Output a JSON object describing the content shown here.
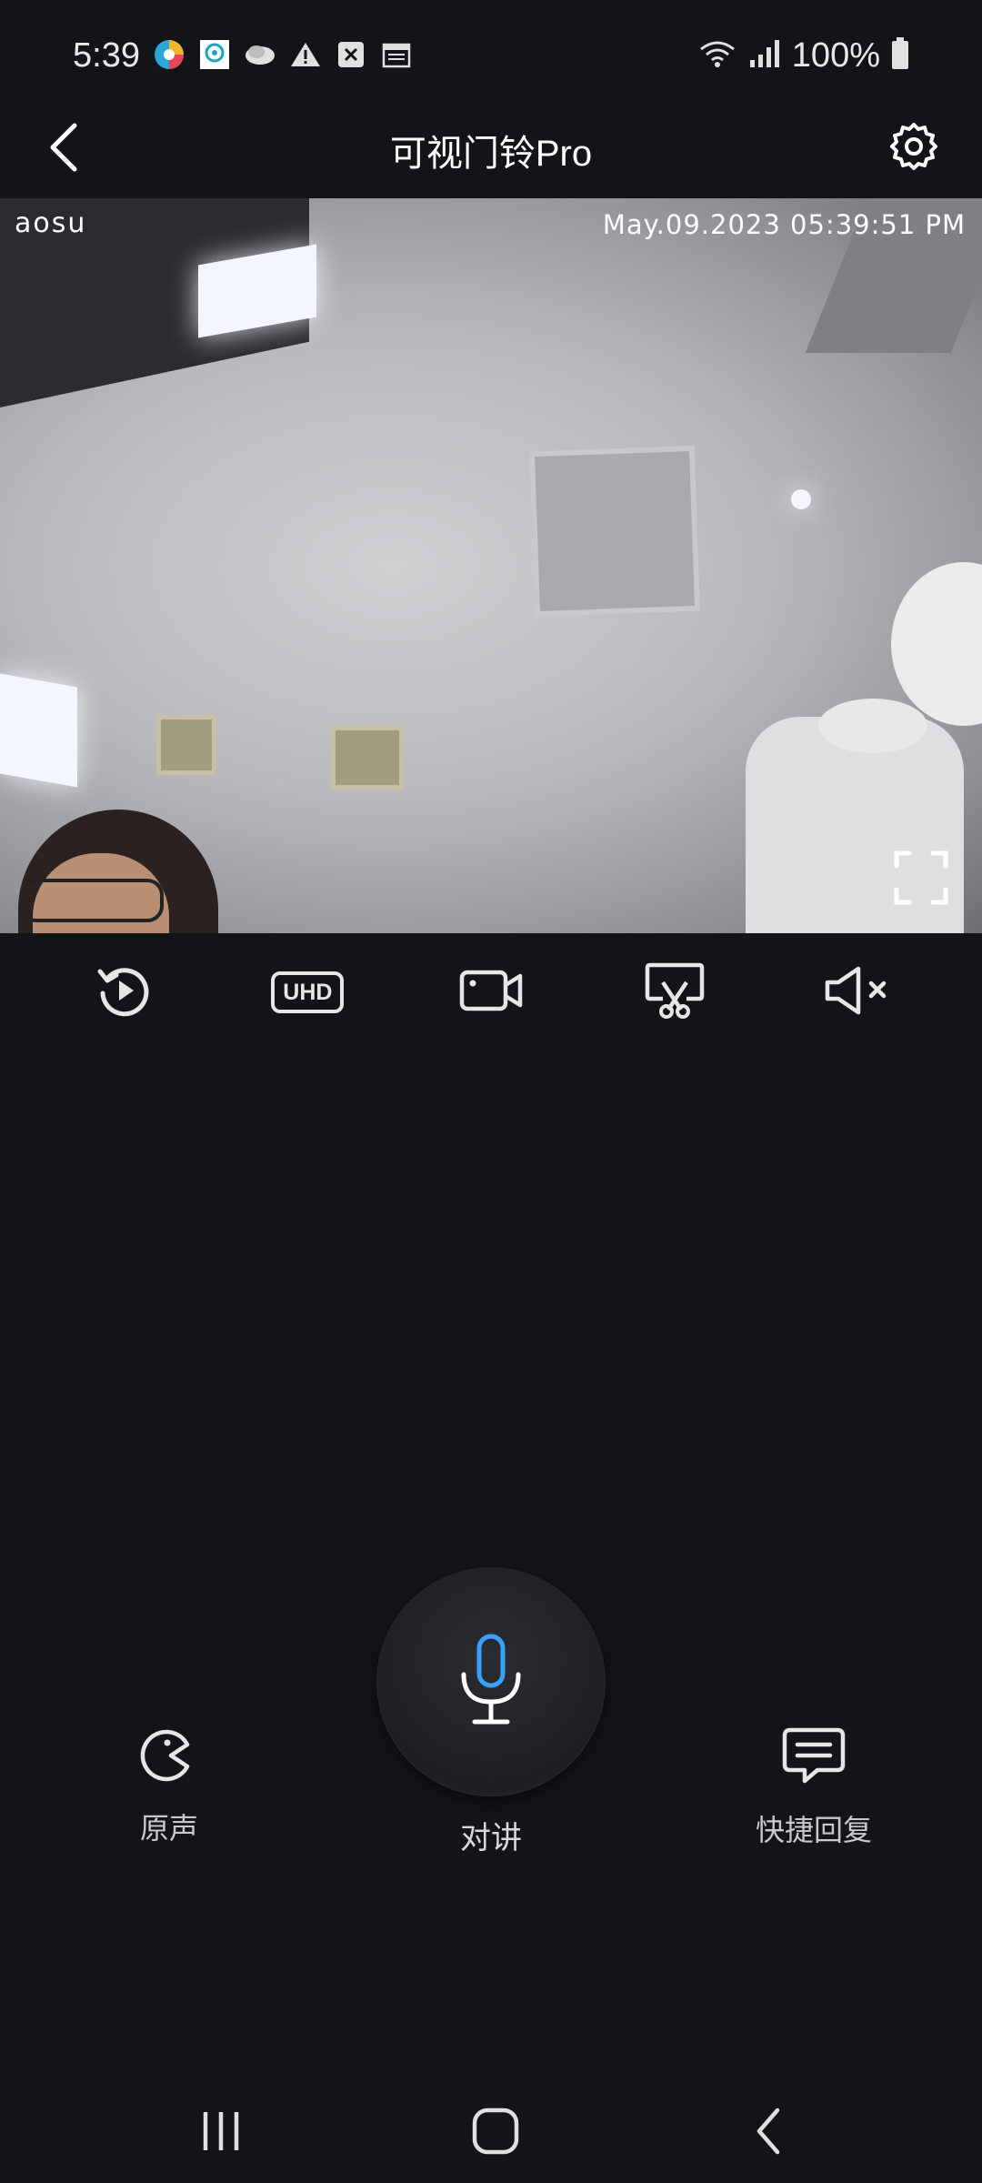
{
  "status_bar": {
    "time": "5:39",
    "battery_text": "100%",
    "notification_icons": [
      "colorful-app-icon",
      "location-pin-icon",
      "cloud-icon",
      "warning-icon",
      "close-box-icon",
      "calendar-icon"
    ]
  },
  "header": {
    "title": "可视门铃Pro",
    "back_icon": "chevron-left-icon",
    "settings_icon": "gear-icon"
  },
  "video": {
    "watermark_logo": "aosu",
    "timestamp": "May.09.2023 05:39:51 PM",
    "fullscreen_icon": "fullscreen-icon"
  },
  "toolbar": {
    "items": [
      {
        "name": "playback",
        "icon": "replay-icon"
      },
      {
        "name": "quality",
        "icon": "uhd-icon",
        "label": "UHD"
      },
      {
        "name": "record",
        "icon": "video-record-icon"
      },
      {
        "name": "screenshot",
        "icon": "screenshot-cut-icon"
      },
      {
        "name": "mute",
        "icon": "speaker-muted-icon"
      }
    ]
  },
  "actions": {
    "original_voice": "原声",
    "talk": "对讲",
    "quick_reply": "快捷回复"
  },
  "colors": {
    "background": "#131417",
    "mic_accent": "#3aa0ff",
    "icon": "#e6e6e6"
  }
}
